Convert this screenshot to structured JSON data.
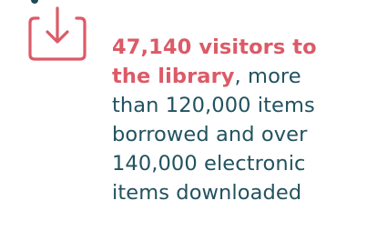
{
  "colors": {
    "accent": "#dc5a67",
    "text": "#22525f"
  },
  "icon": {
    "name": "download-icon"
  },
  "stat": {
    "highlight_line1": "47,140 visitors to",
    "highlight_line2": "the library",
    "line2_rest": ", more",
    "line3": "than 120,000 items",
    "line4": "borrowed and over",
    "line5": "140,000 electronic",
    "line6": "items downloaded"
  }
}
